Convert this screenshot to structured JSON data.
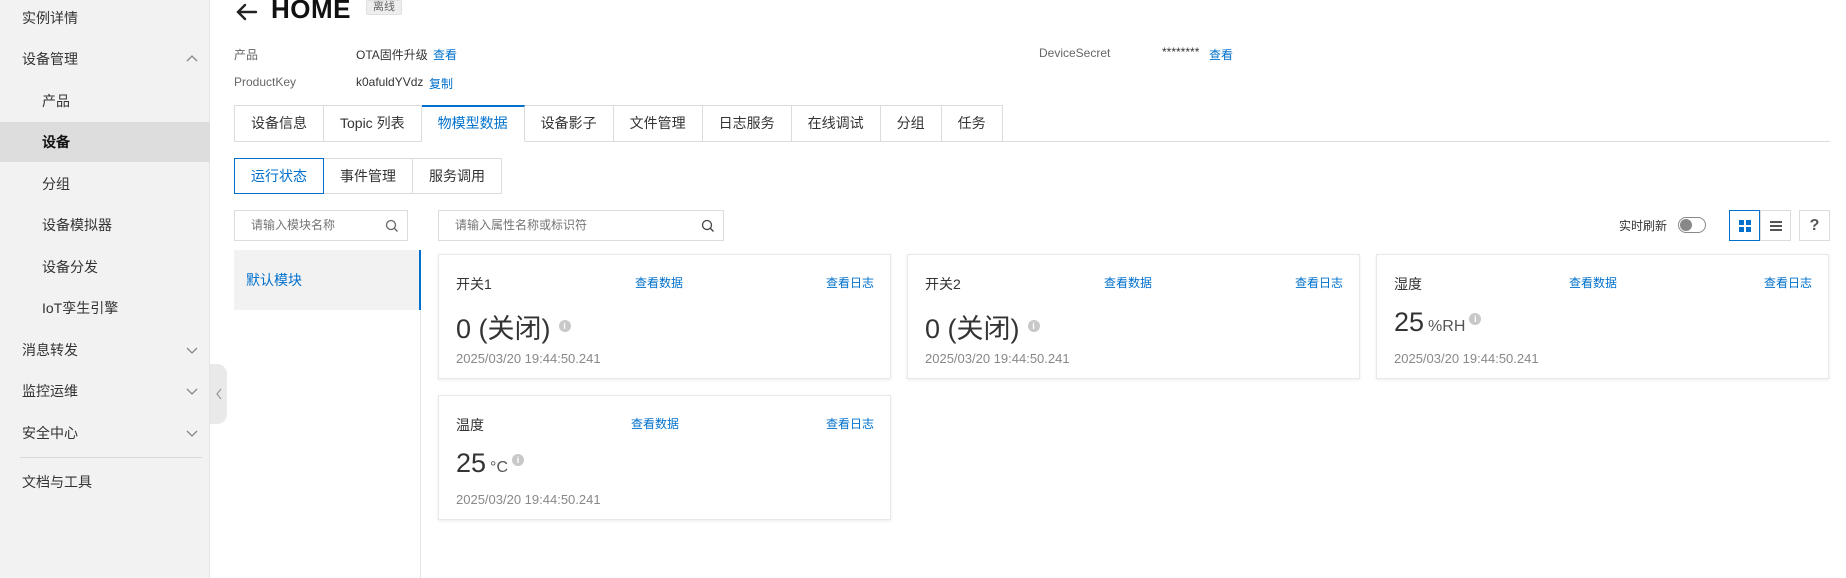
{
  "sidebar": {
    "items": [
      {
        "label": "实例详情"
      },
      {
        "label": "设备管理"
      },
      {
        "label": "产品"
      },
      {
        "label": "设备"
      },
      {
        "label": "分组"
      },
      {
        "label": "设备模拟器"
      },
      {
        "label": "设备分发"
      },
      {
        "label": "IoT孪生引擎"
      },
      {
        "label": "消息转发"
      },
      {
        "label": "监控运维"
      },
      {
        "label": "安全中心"
      },
      {
        "label": "文档与工具"
      }
    ]
  },
  "header": {
    "title": "HOME",
    "status": "离线"
  },
  "meta": {
    "product_label": "产品",
    "product_value": "OTA固件升级",
    "product_link": "查看",
    "productkey_label": "ProductKey",
    "productkey_value": "k0afuldYVdz",
    "productkey_link": "复制",
    "secret_label": "DeviceSecret",
    "secret_value": "********",
    "secret_link": "查看"
  },
  "tabs": [
    {
      "label": "设备信息"
    },
    {
      "label": "Topic 列表"
    },
    {
      "label": "物模型数据"
    },
    {
      "label": "设备影子"
    },
    {
      "label": "文件管理"
    },
    {
      "label": "日志服务"
    },
    {
      "label": "在线调试"
    },
    {
      "label": "分组"
    },
    {
      "label": "任务"
    }
  ],
  "subtabs": [
    {
      "label": "运行状态"
    },
    {
      "label": "事件管理"
    },
    {
      "label": "服务调用"
    }
  ],
  "module_search": {
    "placeholder": "请输入模块名称"
  },
  "property_search": {
    "placeholder": "请输入属性名称或标识符"
  },
  "modules": [
    {
      "label": "默认模块"
    }
  ],
  "toolbar": {
    "realtime_label": "实时刷新",
    "realtime_on": false,
    "help_label": "?"
  },
  "cards": [
    {
      "name": "开关1",
      "value": "0 (关闭)",
      "unit": "",
      "time": "2025/03/20 19:44:50.241",
      "link_data": "查看数据",
      "link_log": "查看日志"
    },
    {
      "name": "开关2",
      "value": "0 (关闭)",
      "unit": "",
      "time": "2025/03/20 19:44:50.241",
      "link_data": "查看数据",
      "link_log": "查看日志"
    },
    {
      "name": "湿度",
      "value": "25",
      "unit": "%RH",
      "time": "2025/03/20 19:44:50.241",
      "link_data": "查看数据",
      "link_log": "查看日志"
    },
    {
      "name": "温度",
      "value": "25",
      "unit": "°C",
      "time": "2025/03/20 19:44:50.241",
      "link_data": "查看数据",
      "link_log": "查看日志"
    }
  ],
  "colors": {
    "accent": "#0070cc",
    "sidebar_bg": "#f2f2f2"
  }
}
